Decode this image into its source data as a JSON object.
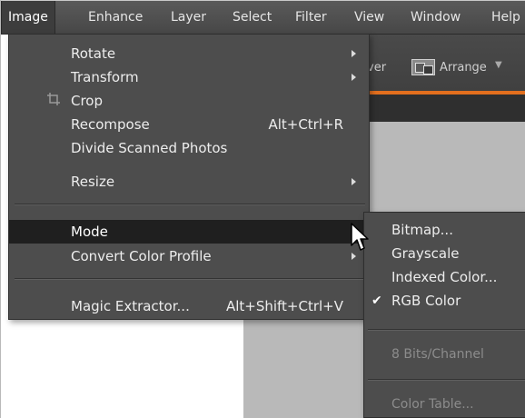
{
  "menubar": {
    "items": [
      "Image",
      "Enhance",
      "Layer",
      "Select",
      "Filter",
      "View",
      "Window",
      "Help"
    ]
  },
  "background": {
    "partial_label": "ver",
    "arrange_label": "Arrange",
    "accent_color": "#e36f1e"
  },
  "image_menu": {
    "rotate": "Rotate",
    "transform": "Transform",
    "crop": "Crop",
    "recompose": "Recompose",
    "recompose_shortcut": "Alt+Ctrl+R",
    "divide": "Divide Scanned Photos",
    "resize": "Resize",
    "mode": "Mode",
    "convert": "Convert Color Profile",
    "magic": "Magic Extractor...",
    "magic_shortcut": "Alt+Shift+Ctrl+V"
  },
  "mode_submenu": {
    "bitmap": "Bitmap...",
    "grayscale": "Grayscale",
    "indexed": "Indexed Color...",
    "rgb": "RGB Color",
    "check": "✔",
    "bits": "8 Bits/Channel",
    "color_table": "Color Table..."
  }
}
